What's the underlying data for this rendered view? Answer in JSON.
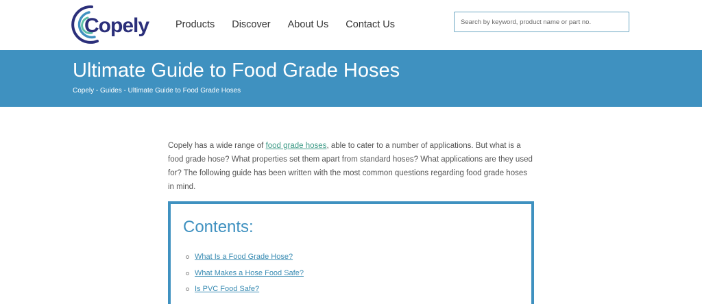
{
  "header": {
    "logo_text": "Copely",
    "nav": [
      {
        "label": "Products"
      },
      {
        "label": "Discover"
      },
      {
        "label": "About Us"
      },
      {
        "label": "Contact Us"
      }
    ],
    "search": {
      "placeholder": "Search by keyword, product name or part no.",
      "value": ""
    }
  },
  "banner": {
    "title": "Ultimate Guide to Food Grade Hoses",
    "breadcrumb": [
      "Copely",
      "Guides",
      "Ultimate Guide to Food Grade Hoses"
    ],
    "breadcrumb_separator": " - "
  },
  "article": {
    "intro_before": "Copely has a wide range of ",
    "intro_link": "food grade hoses",
    "intro_after": ", able to cater to a number of applications. But what is a food grade hose? What properties set them apart from standard hoses? What applications are they used for? The following guide has been written with the most common questions regarding food grade hoses in mind."
  },
  "contents": {
    "title": "Contents:",
    "items": [
      {
        "label": "What Is a Food Grade Hose?"
      },
      {
        "label": "What Makes a Hose Food Safe?"
      },
      {
        "label": "Is PVC Food Safe?"
      }
    ]
  },
  "colors": {
    "brand_blue": "#3f91c0",
    "logo_navy": "#2b2f7a",
    "link_green": "#3c9a86",
    "link_blue": "#3a8cb3"
  },
  "icons": {
    "logo_mark": "copely-swirl-logo"
  }
}
